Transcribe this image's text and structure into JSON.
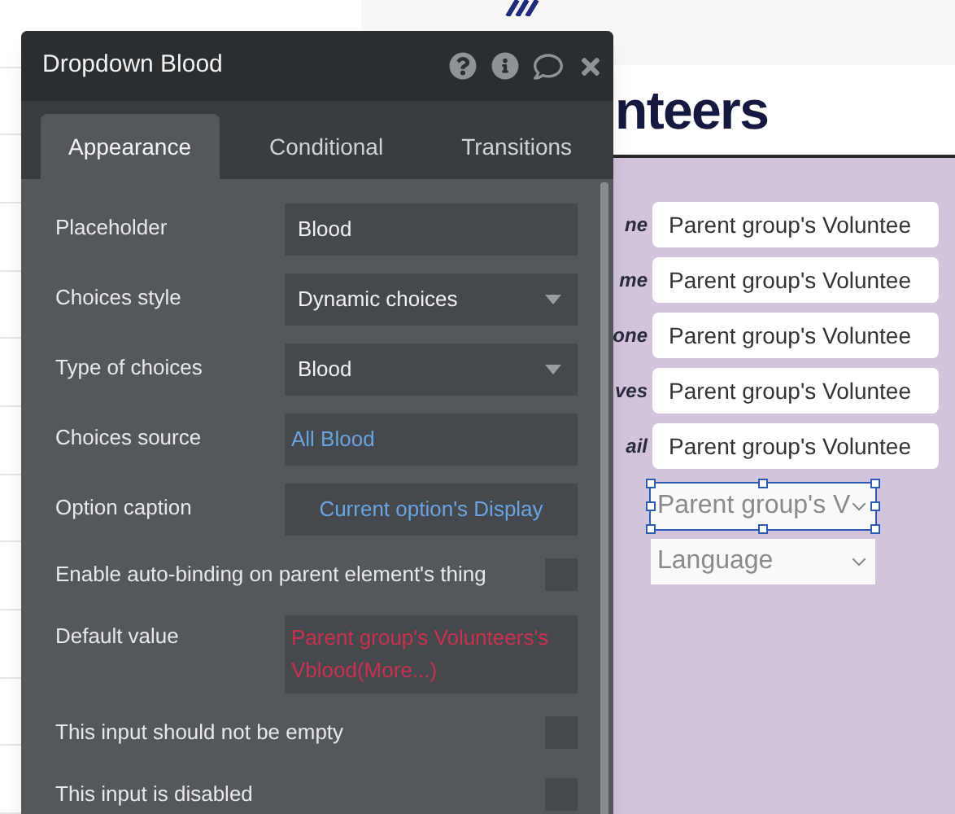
{
  "panel": {
    "title": "Dropdown Blood",
    "tabs": [
      {
        "label": "Appearance",
        "selected": true
      },
      {
        "label": "Conditional",
        "selected": false
      },
      {
        "label": "Transitions",
        "selected": false
      }
    ],
    "properties": [
      {
        "kind": "text",
        "label": "Placeholder",
        "value": "Blood"
      },
      {
        "kind": "dropdown",
        "label": "Choices style",
        "value": "Dynamic choices"
      },
      {
        "kind": "dropdown",
        "label": "Type of choices",
        "value": "Blood"
      },
      {
        "kind": "expression",
        "label": "Choices source",
        "value": "All Blood",
        "error": false,
        "centered": false
      },
      {
        "kind": "expression",
        "label": "Option caption",
        "value": "Current option's Display",
        "error": false,
        "centered": true
      },
      {
        "kind": "checkbox",
        "label": "Enable auto-binding on parent element's thing",
        "checked": false
      },
      {
        "kind": "expression",
        "label": "Default value",
        "value": "Parent group's Volunteers's Vblood(More...)",
        "error": true,
        "centered": false
      },
      {
        "kind": "checkbox",
        "label": "This input should not be empty",
        "checked": false
      },
      {
        "kind": "checkbox",
        "label": "This input is disabled",
        "checked": false
      }
    ]
  },
  "canvas": {
    "heading": "nteers",
    "form_rows": [
      {
        "label": "ne",
        "value": "Parent group's Voluntee"
      },
      {
        "label": "me",
        "value": "Parent group's Voluntee"
      },
      {
        "label": "one",
        "value": "Parent group's Voluntee"
      },
      {
        "label": "ves",
        "value": "Parent group's Voluntee"
      },
      {
        "label": "ail",
        "value": "Parent group's Voluntee"
      }
    ],
    "dropdowns": [
      {
        "value": "Parent group's V",
        "selected": true
      },
      {
        "value": "Language",
        "selected": false
      }
    ]
  }
}
